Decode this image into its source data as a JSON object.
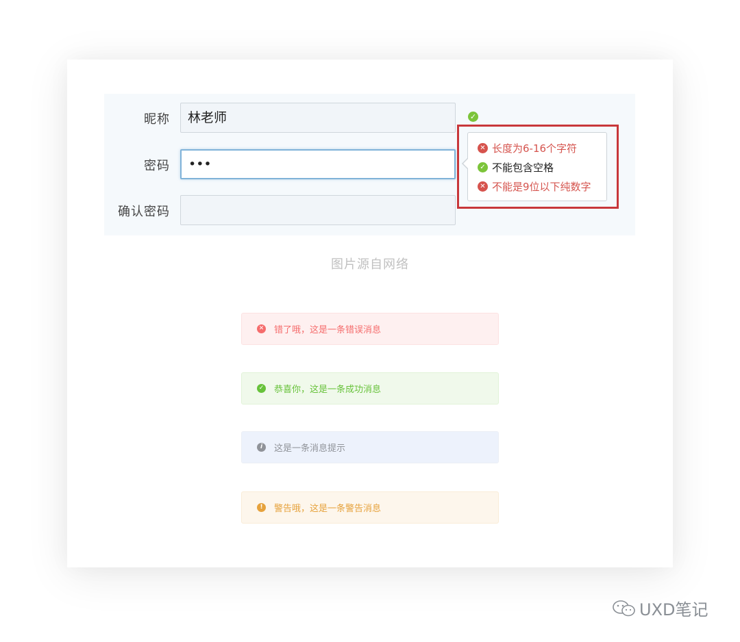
{
  "form": {
    "nickname_label": "昵称",
    "nickname_value": "林老师",
    "password_label": "密码",
    "password_value": "•••",
    "confirm_label": "确认密码",
    "confirm_value": ""
  },
  "validation_tip": {
    "rules": [
      {
        "text": "长度为6-16个字符",
        "status": "error"
      },
      {
        "text": "不能包含空格",
        "status": "ok"
      },
      {
        "text": "不能是9位以下纯数字",
        "status": "error"
      }
    ]
  },
  "caption": "图片源自网络",
  "messages": {
    "error": "错了哦，这是一条错误消息",
    "success": "恭喜你，这是一条成功消息",
    "info": "这是一条消息提示",
    "warning": "警告哦，这是一条警告消息"
  },
  "icons": {
    "ok": "✓",
    "error": "✕",
    "info": "i",
    "warning": "!"
  },
  "watermark": "UXD笔记",
  "colors": {
    "error": "#f56c6c",
    "success": "#67c23a",
    "info": "#909399",
    "warning": "#e6a23c",
    "highlight": "#c8373a"
  }
}
